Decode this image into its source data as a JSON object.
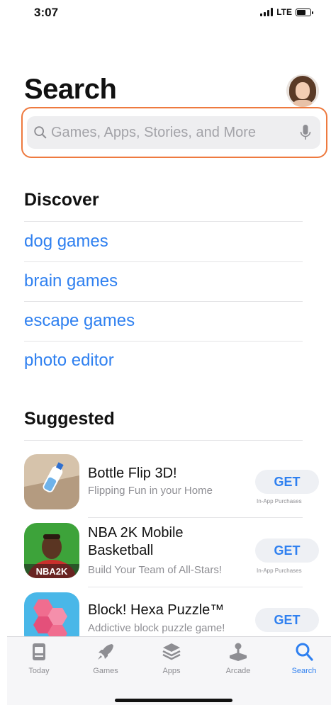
{
  "status_bar": {
    "time": "3:07",
    "network": "LTE"
  },
  "header": {
    "title": "Search"
  },
  "search": {
    "placeholder": "Games, Apps, Stories, and More",
    "value": ""
  },
  "discover": {
    "title": "Discover",
    "items": [
      "dog games",
      "brain games",
      "escape games",
      "photo editor"
    ]
  },
  "suggested": {
    "title": "Suggested",
    "apps": [
      {
        "name": "Bottle Flip 3D!",
        "subtitle": "Flipping Fun in your Home",
        "button": "GET",
        "note": "In-App Purchases",
        "icon": "bottle-flip-icon"
      },
      {
        "name": "NBA 2K Mobile Basketball",
        "subtitle": "Build Your Team of All-Stars!",
        "button": "GET",
        "note": "In-App Purchases",
        "icon": "nba-2k-icon",
        "icon_text": "NBA2K"
      },
      {
        "name": "Block! Hexa Puzzle™",
        "subtitle": "Addictive block puzzle game!",
        "button": "GET",
        "note": "",
        "icon": "hexa-puzzle-icon"
      }
    ]
  },
  "tab_bar": {
    "tabs": [
      {
        "label": "Today",
        "icon": "today-icon",
        "active": false
      },
      {
        "label": "Games",
        "icon": "rocket-icon",
        "active": false
      },
      {
        "label": "Apps",
        "icon": "layers-icon",
        "active": false
      },
      {
        "label": "Arcade",
        "icon": "joystick-icon",
        "active": false
      },
      {
        "label": "Search",
        "icon": "search-icon",
        "active": true
      }
    ]
  },
  "colors": {
    "accent": "#2f80f0",
    "highlight": "#ee7a3f",
    "inactive": "#8e8e93"
  }
}
